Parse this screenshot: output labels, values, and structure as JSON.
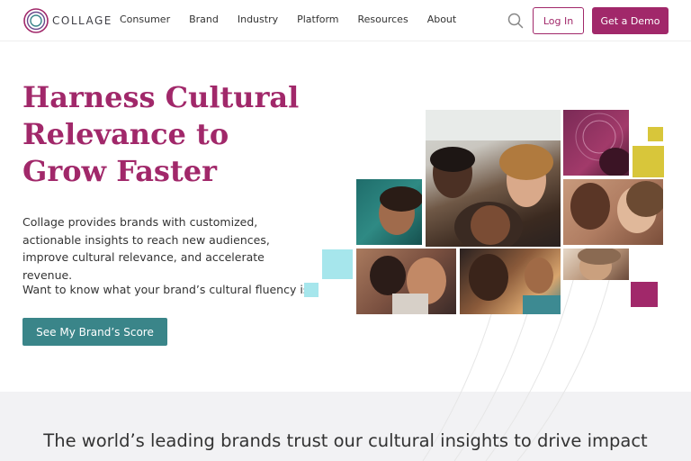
{
  "nav": {
    "logo_text": "COLLAGE",
    "items": [
      "Consumer",
      "Brand",
      "Industry",
      "Platform",
      "Resources",
      "About"
    ],
    "login_label": "Log In",
    "demo_label": "Get a Demo"
  },
  "hero": {
    "title_lines": [
      "Harness Cultural",
      "Relevance to",
      "Grow Faster"
    ],
    "description": "Collage provides brands with customized, actionable insights to reach new audiences, improve cultural relevance, and accelerate revenue.",
    "question": "Want to know what your brand’s cultural fluency is?",
    "cta_label": "See My Brand’s Score"
  },
  "trust": {
    "headline": "The world’s leading brands trust our cultural insights to drive impact"
  },
  "colors": {
    "brand": "#a1286a",
    "teal_button": "#3a8589",
    "aqua": "#a6e6ec",
    "yellow": "#d8c63a",
    "band": "#f2f2f4"
  },
  "icons": [
    "collage-logo-icon",
    "search-icon"
  ]
}
